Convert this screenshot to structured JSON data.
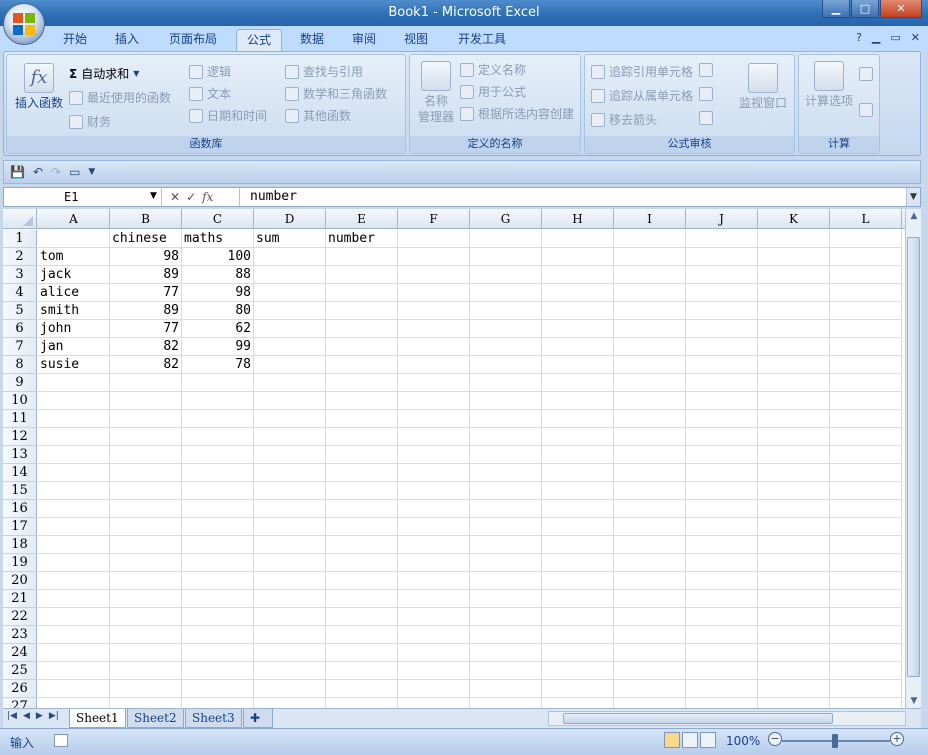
{
  "window": {
    "title": "Book1 - Microsoft Excel"
  },
  "ribbon_tabs": [
    "开始",
    "插入",
    "页面布局",
    "公式",
    "数据",
    "审阅",
    "视图",
    "开发工具"
  ],
  "ribbon": {
    "function_library": {
      "insert_function": "插入函数",
      "autosum": "自动求和",
      "recently_used": "最近使用的函数",
      "financial": "财务",
      "logical": "逻辑",
      "text": "文本",
      "date_time": "日期和时间",
      "lookup_reference": "查找与引用",
      "math_trig": "数学和三角函数",
      "more_functions": "其他函数",
      "title": "函数库"
    },
    "defined_names": {
      "name_manager_1": "名称",
      "name_manager_2": "管理器",
      "define_name": "定义名称",
      "use_in_formula": "用于公式",
      "create_from_selection": "根据所选内容创建",
      "title": "定义的名称"
    },
    "formula_auditing": {
      "trace_precedents": "追踪引用单元格",
      "trace_dependents": "追踪从属单元格",
      "remove_arrows": "移去箭头",
      "watch_window": "监视窗口",
      "title": "公式审核"
    },
    "calculation": {
      "calc_options": "计算选项",
      "title": "计算"
    }
  },
  "formula_bar": {
    "name_box": "E1",
    "formula": "number",
    "fx_label": "fx"
  },
  "grid": {
    "columns": [
      "A",
      "B",
      "C",
      "D",
      "E",
      "F",
      "G",
      "H",
      "I",
      "J",
      "K",
      "L"
    ],
    "row_numbers": [
      "1",
      "2",
      "3",
      "4",
      "5",
      "6",
      "7",
      "8",
      "9",
      "10",
      "11",
      "12",
      "13",
      "14",
      "15",
      "16",
      "17",
      "18",
      "19",
      "20",
      "21",
      "22",
      "23",
      "24",
      "25",
      "26",
      "27"
    ],
    "header_row": [
      "",
      "chinese",
      "maths",
      "sum",
      "number"
    ],
    "rows": [
      [
        "tom",
        "98",
        "100"
      ],
      [
        "jack",
        "89",
        "88"
      ],
      [
        "alice",
        "77",
        "98"
      ],
      [
        "smith",
        "89",
        "80"
      ],
      [
        "john",
        "77",
        "62"
      ],
      [
        "jan",
        "82",
        "99"
      ],
      [
        "susie",
        "82",
        "78"
      ]
    ]
  },
  "sheets": [
    "Sheet1",
    "Sheet2",
    "Sheet3"
  ],
  "status": {
    "mode": "输入",
    "zoom": "100%"
  }
}
